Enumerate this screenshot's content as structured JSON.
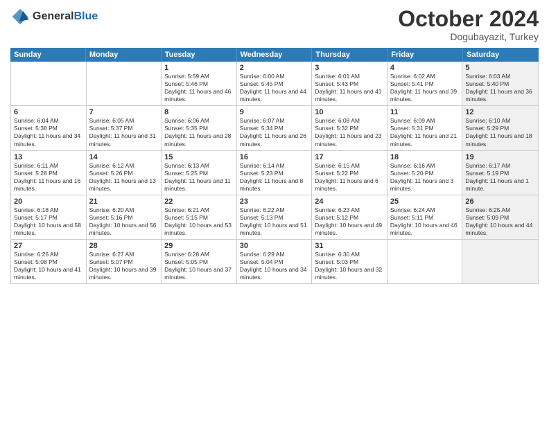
{
  "header": {
    "logo_general": "General",
    "logo_blue": "Blue",
    "month": "October 2024",
    "location": "Dogubayazit, Turkey"
  },
  "weekdays": [
    "Sunday",
    "Monday",
    "Tuesday",
    "Wednesday",
    "Thursday",
    "Friday",
    "Saturday"
  ],
  "rows": [
    [
      {
        "day": "",
        "sunrise": "",
        "sunset": "",
        "daylight": "",
        "shaded": false
      },
      {
        "day": "",
        "sunrise": "",
        "sunset": "",
        "daylight": "",
        "shaded": false
      },
      {
        "day": "1",
        "sunrise": "Sunrise: 5:59 AM",
        "sunset": "Sunset: 5:46 PM",
        "daylight": "Daylight: 11 hours and 46 minutes.",
        "shaded": false
      },
      {
        "day": "2",
        "sunrise": "Sunrise: 6:00 AM",
        "sunset": "Sunset: 5:45 PM",
        "daylight": "Daylight: 11 hours and 44 minutes.",
        "shaded": false
      },
      {
        "day": "3",
        "sunrise": "Sunrise: 6:01 AM",
        "sunset": "Sunset: 5:43 PM",
        "daylight": "Daylight: 11 hours and 41 minutes.",
        "shaded": false
      },
      {
        "day": "4",
        "sunrise": "Sunrise: 6:02 AM",
        "sunset": "Sunset: 5:41 PM",
        "daylight": "Daylight: 11 hours and 39 minutes.",
        "shaded": false
      },
      {
        "day": "5",
        "sunrise": "Sunrise: 6:03 AM",
        "sunset": "Sunset: 5:40 PM",
        "daylight": "Daylight: 11 hours and 36 minutes.",
        "shaded": true
      }
    ],
    [
      {
        "day": "6",
        "sunrise": "Sunrise: 6:04 AM",
        "sunset": "Sunset: 5:38 PM",
        "daylight": "Daylight: 11 hours and 34 minutes.",
        "shaded": false
      },
      {
        "day": "7",
        "sunrise": "Sunrise: 6:05 AM",
        "sunset": "Sunset: 5:37 PM",
        "daylight": "Daylight: 11 hours and 31 minutes.",
        "shaded": false
      },
      {
        "day": "8",
        "sunrise": "Sunrise: 6:06 AM",
        "sunset": "Sunset: 5:35 PM",
        "daylight": "Daylight: 11 hours and 28 minutes.",
        "shaded": false
      },
      {
        "day": "9",
        "sunrise": "Sunrise: 6:07 AM",
        "sunset": "Sunset: 5:34 PM",
        "daylight": "Daylight: 11 hours and 26 minutes.",
        "shaded": false
      },
      {
        "day": "10",
        "sunrise": "Sunrise: 6:08 AM",
        "sunset": "Sunset: 5:32 PM",
        "daylight": "Daylight: 11 hours and 23 minutes.",
        "shaded": false
      },
      {
        "day": "11",
        "sunrise": "Sunrise: 6:09 AM",
        "sunset": "Sunset: 5:31 PM",
        "daylight": "Daylight: 11 hours and 21 minutes.",
        "shaded": false
      },
      {
        "day": "12",
        "sunrise": "Sunrise: 6:10 AM",
        "sunset": "Sunset: 5:29 PM",
        "daylight": "Daylight: 11 hours and 18 minutes.",
        "shaded": true
      }
    ],
    [
      {
        "day": "13",
        "sunrise": "Sunrise: 6:11 AM",
        "sunset": "Sunset: 5:28 PM",
        "daylight": "Daylight: 11 hours and 16 minutes.",
        "shaded": false
      },
      {
        "day": "14",
        "sunrise": "Sunrise: 6:12 AM",
        "sunset": "Sunset: 5:26 PM",
        "daylight": "Daylight: 11 hours and 13 minutes.",
        "shaded": false
      },
      {
        "day": "15",
        "sunrise": "Sunrise: 6:13 AM",
        "sunset": "Sunset: 5:25 PM",
        "daylight": "Daylight: 11 hours and 11 minutes.",
        "shaded": false
      },
      {
        "day": "16",
        "sunrise": "Sunrise: 6:14 AM",
        "sunset": "Sunset: 5:23 PM",
        "daylight": "Daylight: 11 hours and 8 minutes.",
        "shaded": false
      },
      {
        "day": "17",
        "sunrise": "Sunrise: 6:15 AM",
        "sunset": "Sunset: 5:22 PM",
        "daylight": "Daylight: 11 hours and 6 minutes.",
        "shaded": false
      },
      {
        "day": "18",
        "sunrise": "Sunrise: 6:16 AM",
        "sunset": "Sunset: 5:20 PM",
        "daylight": "Daylight: 11 hours and 3 minutes.",
        "shaded": false
      },
      {
        "day": "19",
        "sunrise": "Sunrise: 6:17 AM",
        "sunset": "Sunset: 5:19 PM",
        "daylight": "Daylight: 11 hours and 1 minute.",
        "shaded": true
      }
    ],
    [
      {
        "day": "20",
        "sunrise": "Sunrise: 6:18 AM",
        "sunset": "Sunset: 5:17 PM",
        "daylight": "Daylight: 10 hours and 58 minutes.",
        "shaded": false
      },
      {
        "day": "21",
        "sunrise": "Sunrise: 6:20 AM",
        "sunset": "Sunset: 5:16 PM",
        "daylight": "Daylight: 10 hours and 56 minutes.",
        "shaded": false
      },
      {
        "day": "22",
        "sunrise": "Sunrise: 6:21 AM",
        "sunset": "Sunset: 5:15 PM",
        "daylight": "Daylight: 10 hours and 53 minutes.",
        "shaded": false
      },
      {
        "day": "23",
        "sunrise": "Sunrise: 6:22 AM",
        "sunset": "Sunset: 5:13 PM",
        "daylight": "Daylight: 10 hours and 51 minutes.",
        "shaded": false
      },
      {
        "day": "24",
        "sunrise": "Sunrise: 6:23 AM",
        "sunset": "Sunset: 5:12 PM",
        "daylight": "Daylight: 10 hours and 49 minutes.",
        "shaded": false
      },
      {
        "day": "25",
        "sunrise": "Sunrise: 6:24 AM",
        "sunset": "Sunset: 5:11 PM",
        "daylight": "Daylight: 10 hours and 46 minutes.",
        "shaded": false
      },
      {
        "day": "26",
        "sunrise": "Sunrise: 6:25 AM",
        "sunset": "Sunset: 5:09 PM",
        "daylight": "Daylight: 10 hours and 44 minutes.",
        "shaded": true
      }
    ],
    [
      {
        "day": "27",
        "sunrise": "Sunrise: 6:26 AM",
        "sunset": "Sunset: 5:08 PM",
        "daylight": "Daylight: 10 hours and 41 minutes.",
        "shaded": false
      },
      {
        "day": "28",
        "sunrise": "Sunrise: 6:27 AM",
        "sunset": "Sunset: 5:07 PM",
        "daylight": "Daylight: 10 hours and 39 minutes.",
        "shaded": false
      },
      {
        "day": "29",
        "sunrise": "Sunrise: 6:28 AM",
        "sunset": "Sunset: 5:05 PM",
        "daylight": "Daylight: 10 hours and 37 minutes.",
        "shaded": false
      },
      {
        "day": "30",
        "sunrise": "Sunrise: 6:29 AM",
        "sunset": "Sunset: 5:04 PM",
        "daylight": "Daylight: 10 hours and 34 minutes.",
        "shaded": false
      },
      {
        "day": "31",
        "sunrise": "Sunrise: 6:30 AM",
        "sunset": "Sunset: 5:03 PM",
        "daylight": "Daylight: 10 hours and 32 minutes.",
        "shaded": false
      },
      {
        "day": "",
        "sunrise": "",
        "sunset": "",
        "daylight": "",
        "shaded": false
      },
      {
        "day": "",
        "sunrise": "",
        "sunset": "",
        "daylight": "",
        "shaded": true
      }
    ]
  ]
}
